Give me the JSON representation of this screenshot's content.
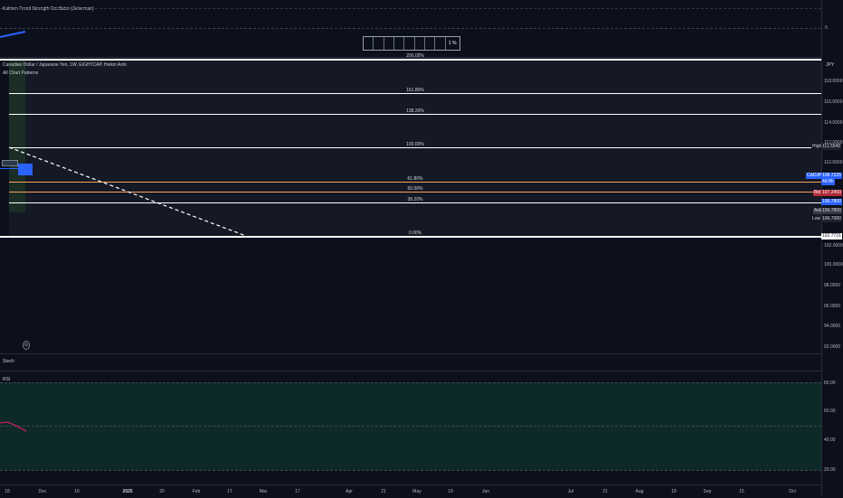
{
  "top_pane": {
    "indicator_label": "Kalmen Trend Strength Oscillator (Zeiierman)",
    "zero_label": "0",
    "box_percent": "1 %"
  },
  "main": {
    "symbol_line": "Canadian Dollar / Japanese Yen, 1W, EIGHTCAP, Heikin Ashi",
    "pattern_label": "All Chart Patterns",
    "currency": "JPY",
    "price_ticks": [
      "118.0000",
      "116.0000",
      "114.0000",
      "112.0000",
      "110.0000",
      "102.0000",
      "100.0000",
      "98.0000",
      "96.0000",
      "94.0000",
      "92.0000"
    ],
    "fib_levels": [
      {
        "label": "200.00%",
        "color": "#ffffff"
      },
      {
        "label": "161.80%",
        "color": "#ffffff"
      },
      {
        "label": "138.20%",
        "color": "#ffffff"
      },
      {
        "label": "100.00%",
        "color": "#ffffff"
      },
      {
        "label": "61.80%",
        "color": "#f7a25b"
      },
      {
        "label": "50.00%",
        "color": "#f7a25b"
      },
      {
        "label": "38.20%",
        "color": "#ffffff"
      },
      {
        "label": "0.00%",
        "color": "#ffffff"
      }
    ],
    "tags": {
      "high_label": "High",
      "high_value": "111.5540",
      "pair_label": "CADJPY",
      "pair_value": "108.7225",
      "pair_sub": "4d 8h",
      "bid_label": "Bid",
      "bid_value": "107.2493",
      "blue2_value": "106.7800",
      "ask_label": "Ask",
      "ask_value": "106.7800",
      "low_label": "Low",
      "low_value": "106.7680",
      "bottom_value": "102.7731"
    }
  },
  "stoch_pane": {
    "label": "Stoch"
  },
  "rsi_pane": {
    "label": "RSI",
    "ticks": [
      "80.00",
      "60.00",
      "40.00",
      "20.00"
    ]
  },
  "date_axis": [
    "18",
    "Dec",
    "16",
    "2025",
    "20",
    "Feb",
    "17",
    "Mar",
    "17",
    "Apr",
    "21",
    "May",
    "19",
    "Jun",
    "Jul",
    "21",
    "Aug",
    "18",
    "Sep",
    "15",
    "Oct"
  ],
  "colors": {
    "accent_blue": "#2962ff",
    "fib_orange": "#f7a25b",
    "rsi_fill": "#0d2a29",
    "rsi_line": "#e91e63"
  }
}
